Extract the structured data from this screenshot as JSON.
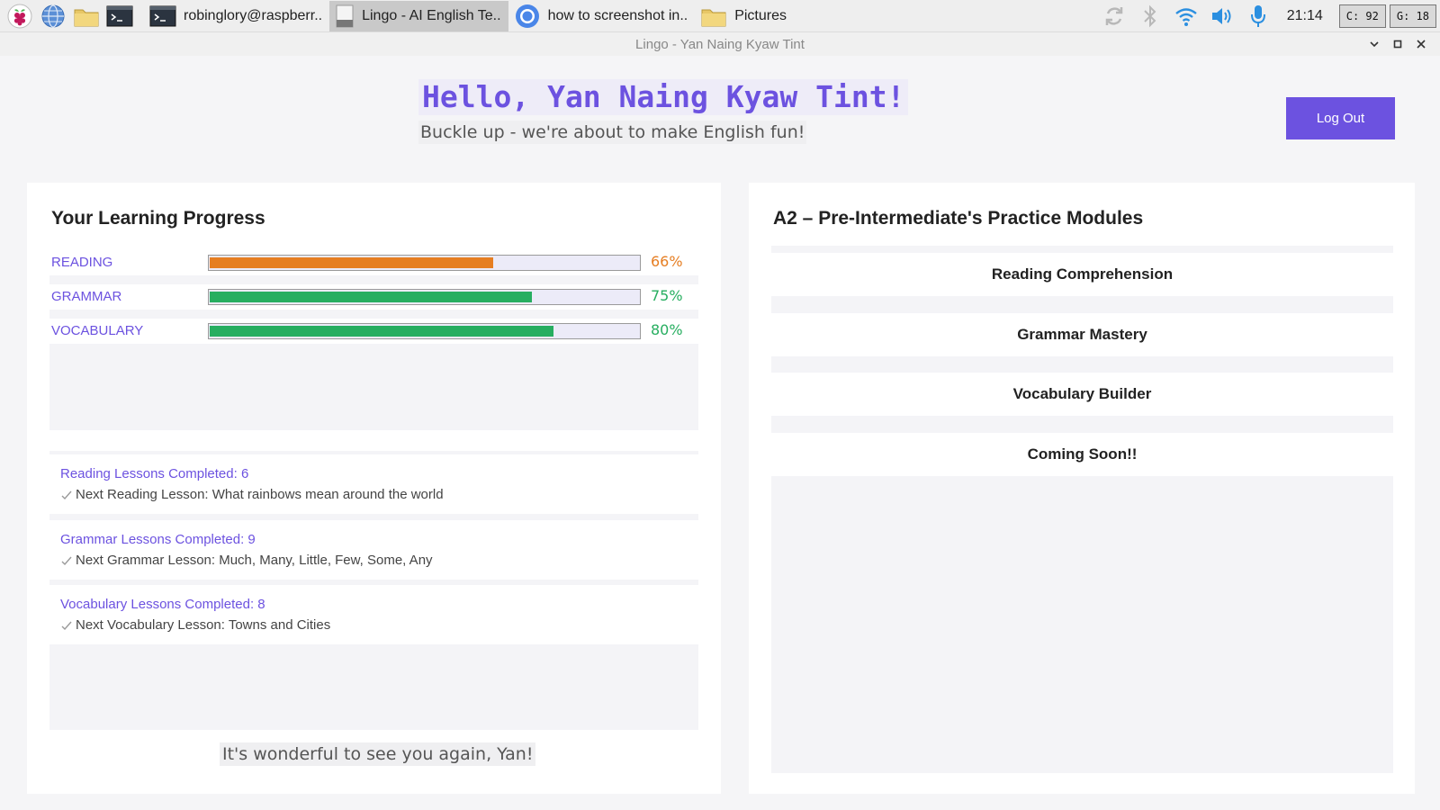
{
  "taskbar": {
    "launchers": [
      {
        "icon": "raspberry-pi-menu-icon"
      },
      {
        "icon": "web-browser-icon"
      },
      {
        "icon": "file-manager-icon"
      },
      {
        "icon": "terminal-icon"
      }
    ],
    "tasks": [
      {
        "icon": "terminal-icon",
        "label": "robinglory@raspberr.."
      },
      {
        "icon": "app-window-icon",
        "label": "Lingo - AI English Te.."
      },
      {
        "icon": "chromium-icon",
        "label": "how to screenshot in.."
      },
      {
        "icon": "folder-icon",
        "label": "Pictures"
      }
    ],
    "tray": {
      "icons": [
        "update-icon",
        "bluetooth-icon",
        "wifi-icon",
        "volume-icon",
        "microphone-icon"
      ],
      "clock": "21:14",
      "cpu_label": "C: 92",
      "gpu_label": "G: 18"
    }
  },
  "window": {
    "title": "Lingo - Yan Naing Kyaw Tint"
  },
  "header": {
    "greeting": "Hello, Yan Naing Kyaw Tint!",
    "subtitle": "Buckle up - we're about to make English fun!",
    "logout_label": "Log Out",
    "accent_color": "#6c52e0"
  },
  "progress": {
    "title": "Your Learning Progress",
    "bars": [
      {
        "label": "READING",
        "percent_text": "66%",
        "value": 0.66,
        "color": "#e67e22"
      },
      {
        "label": "GRAMMAR",
        "percent_text": "75%",
        "value": 0.75,
        "color": "#27ae60"
      },
      {
        "label": "VOCABULARY",
        "percent_text": "80%",
        "value": 0.8,
        "color": "#27ae60"
      }
    ],
    "lessons": [
      {
        "completed": "Reading Lessons Completed: 6",
        "next": "Next Reading Lesson: What rainbows mean around the world"
      },
      {
        "completed": "Grammar Lessons Completed: 9",
        "next": "Next Grammar Lesson: Much, Many, Little, Few, Some, Any"
      },
      {
        "completed": "Vocabulary Lessons Completed: 8",
        "next": "Next Vocabulary Lesson: Towns and Cities"
      }
    ],
    "footer_message": "It's wonderful to see you again, Yan!"
  },
  "modules": {
    "title": "A2 – Pre-Intermediate's Practice Modules",
    "items": [
      {
        "label": "Reading Comprehension"
      },
      {
        "label": "Grammar Mastery"
      },
      {
        "label": "Vocabulary Builder"
      },
      {
        "label": "Coming Soon!!"
      }
    ]
  }
}
